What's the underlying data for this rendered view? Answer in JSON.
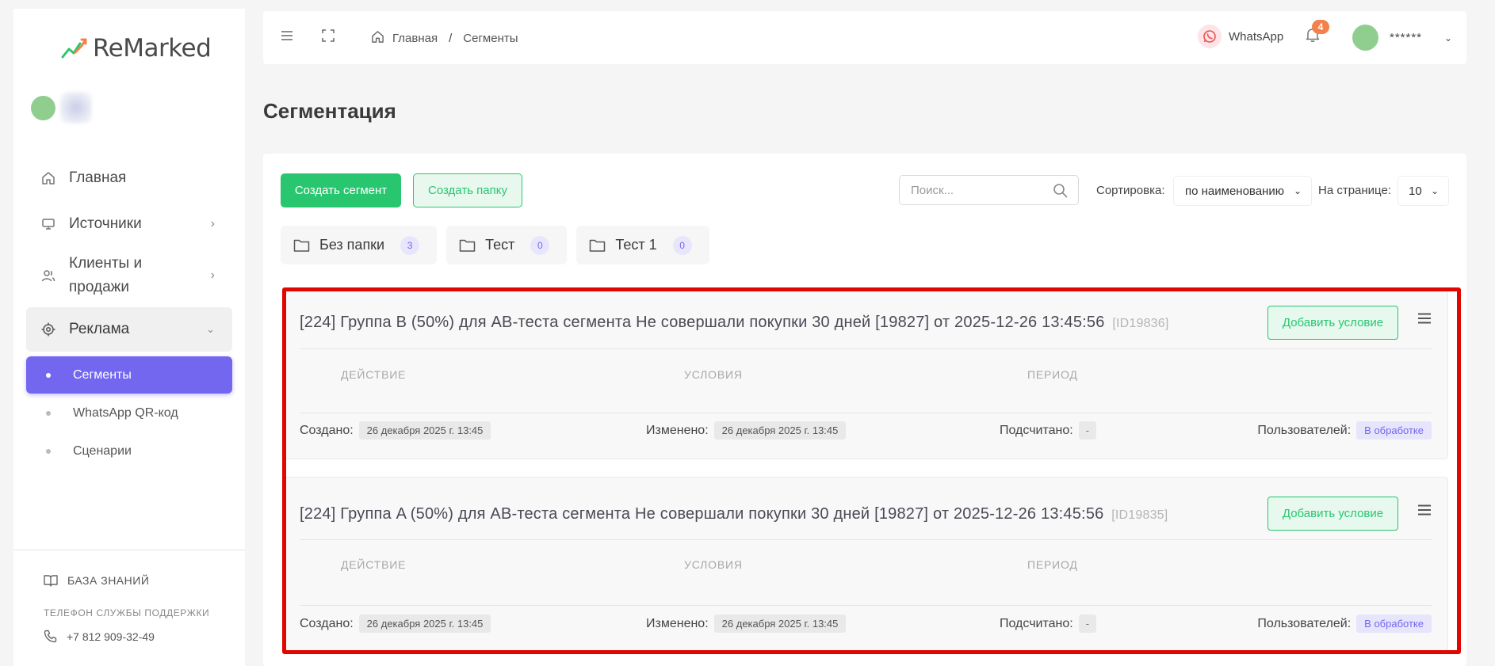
{
  "brand": {
    "name": "ReMarked"
  },
  "sidebar": {
    "items": [
      {
        "label": "Главная",
        "icon": "home-icon"
      },
      {
        "label": "Источники",
        "icon": "monitor-icon"
      },
      {
        "label": "Клиенты и продажи",
        "icon": "users-icon"
      },
      {
        "label": "Реклама",
        "icon": "target-icon"
      }
    ],
    "sub_items": [
      {
        "label": "Сегменты"
      },
      {
        "label": "WhatsApp QR-код"
      },
      {
        "label": "Сценарии"
      }
    ],
    "knowledge_base": "БАЗА ЗНАНИЙ",
    "support_label": "ТЕЛЕФОН СЛУЖБЫ ПОДДЕРЖКИ",
    "phone": "+7 812 909-32-49"
  },
  "header": {
    "breadcrumb": {
      "home": "Главная",
      "separator": "/",
      "current": "Сегменты"
    },
    "whatsapp_label": "WhatsApp",
    "notifications_count": "4",
    "user_name": "******"
  },
  "page": {
    "title": "Сегментация"
  },
  "toolbar": {
    "create_segment": "Создать сегмент",
    "create_folder": "Создать папку",
    "search_placeholder": "Поиск...",
    "sort_label": "Сортировка:",
    "sort_value": "по наименованию",
    "per_page_label": "На странице:",
    "per_page_value": "10"
  },
  "folders": [
    {
      "name": "Без папки",
      "count": "3"
    },
    {
      "name": "Тест",
      "count": "0"
    },
    {
      "name": "Тест 1",
      "count": "0"
    }
  ],
  "segments": [
    {
      "title": "[224] Группа B (50%) для AB-теста сегмента Не совершали покупки 30 дней [19827] от 2025-12-26 13:45:56",
      "id": "[ID19836]",
      "add_condition": "Добавить условие",
      "col_action": "ДЕЙСТВИЕ",
      "col_conditions": "УСЛОВИЯ",
      "col_period": "ПЕРИОД",
      "created_label": "Создано:",
      "created_value": "26 декабря 2025 г. 13:45",
      "modified_label": "Изменено:",
      "modified_value": "26 декабря 2025 г. 13:45",
      "counted_label": "Подсчитано:",
      "counted_value": "-",
      "users_label": "Пользователей:",
      "users_value": "В обработке"
    },
    {
      "title": "[224] Группа A (50%) для AB-теста сегмента Не совершали покупки 30 дней [19827] от 2025-12-26 13:45:56",
      "id": "[ID19835]",
      "add_condition": "Добавить условие",
      "col_action": "ДЕЙСТВИЕ",
      "col_conditions": "УСЛОВИЯ",
      "col_period": "ПЕРИОД",
      "created_label": "Создано:",
      "created_value": "26 декабря 2025 г. 13:45",
      "modified_label": "Изменено:",
      "modified_value": "26 декабря 2025 г. 13:45",
      "counted_label": "Подсчитано:",
      "counted_value": "-",
      "users_label": "Пользователей:",
      "users_value": "В обработке"
    }
  ],
  "colors": {
    "accent": "#7367f0",
    "success": "#28c76f",
    "highlight": "#e10600",
    "notification": "#f4804b"
  }
}
